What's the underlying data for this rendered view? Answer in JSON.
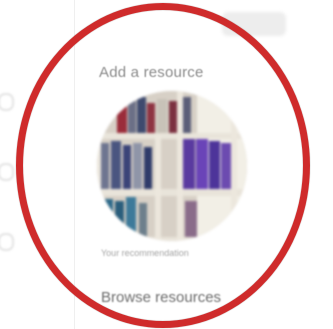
{
  "section": {
    "title": "Add a resource",
    "image_caption": "Your recommendation",
    "browse_title": "Browse resources"
  },
  "colors": {
    "highlight_ring": "#cf2b2b",
    "heading_text": "#8a8a8a"
  },
  "icons": {
    "sidebar": [
      "nav-icon",
      "nav-icon",
      "nav-icon"
    ],
    "image": "bookshelf-image"
  }
}
